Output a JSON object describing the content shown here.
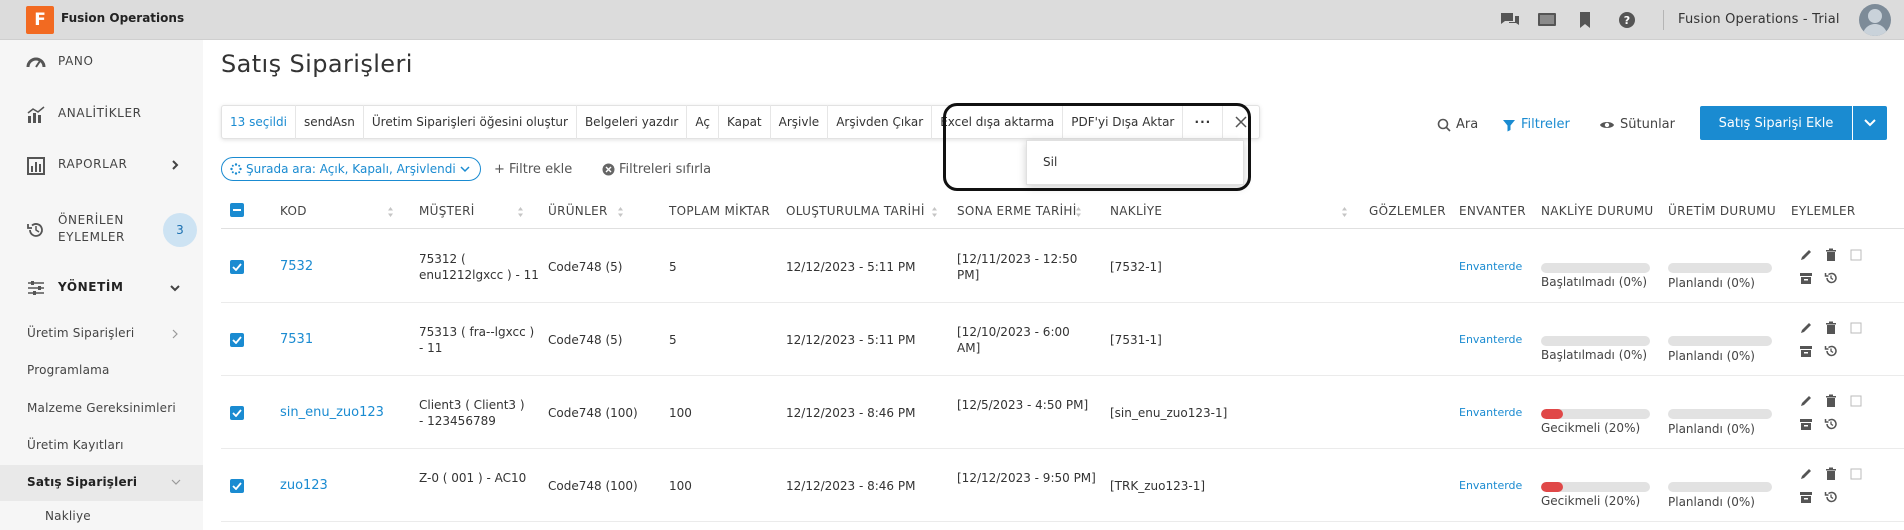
{
  "app": {
    "logo_letter": "F",
    "title": "Fusion Operations",
    "tenant": "Fusion Operations - Trial"
  },
  "topbar_icons": [
    "chat-icon",
    "screen-icon",
    "bookmark-icon",
    "help-icon"
  ],
  "sidebar": {
    "items": [
      {
        "label": "PANO",
        "icon": "dashboard-icon"
      },
      {
        "label": "ANALİTİKLER",
        "icon": "analytics-icon"
      },
      {
        "label": "RAPORLAR",
        "icon": "reports-icon"
      },
      {
        "label": "ÖNERİLEN",
        "label2": "EYLEMLER",
        "icon": "history-icon",
        "badge": "3"
      },
      {
        "label": "YÖNETİM",
        "icon": "settings-sliders-icon"
      }
    ],
    "sub_items": [
      "Üretim Siparişleri",
      "Programlama",
      "Malzeme Gereksinimleri",
      "Üretim Kayıtları",
      "Satış Siparişleri"
    ],
    "sub_sub_item": "Nakliye"
  },
  "page": {
    "title": "Satış Siparişleri"
  },
  "actionbar": {
    "selected": "13 seçildi",
    "items": [
      "sendAsn",
      "Üretim Siparişleri öğesini oluştur",
      "Belgeleri yazdır",
      "Aç",
      "Kapat",
      "Arşivle",
      "Arşivden Çıkar",
      "Excel dışa aktarma",
      "PDF'yi Dışa Aktar"
    ],
    "more": "···"
  },
  "dropdown": {
    "item": "Sil"
  },
  "toolbar": {
    "search": "Ara",
    "filters": "Filtreler",
    "columns": "Sütunlar",
    "add_button": "Satış Siparişi Ekle"
  },
  "filters": {
    "chip": "Şurada ara: Açık, Kapalı, Arşivlendi",
    "add": "+ Filtre ekle",
    "reset": "Filtreleri sıfırla"
  },
  "table": {
    "columns": [
      "KOD",
      "MÜŞTERİ",
      "ÜRÜNLER",
      "TOPLAM MİKTAR",
      "OLUŞTURULMA TARİHİ",
      "SONA ERME TARİHİ",
      "NAKLİYE",
      "GÖZLEMLER",
      "ENVANTER",
      "NAKLİYE DURUMU",
      "ÜRETİM DURUMU",
      "EYLEMLER"
    ],
    "rows": [
      {
        "code": "7532",
        "customer": [
          "75312 (",
          "enu1212lgxcc ) - 11"
        ],
        "products": "Code748 (5)",
        "qty": "5",
        "created": "12/12/2023 - 5:11 PM",
        "expires": [
          "[12/11/2023 - 12:50",
          "PM]"
        ],
        "shipping": "[7532-1]",
        "inventory": "Envanterde",
        "ship_status": "Başlatılmadı (0%)",
        "ship_progress": 0,
        "prod_status": "Planlandı (0%)",
        "prod_progress": 0
      },
      {
        "code": "7531",
        "customer": [
          "75313 ( fra--lgxcc )",
          "- 11"
        ],
        "products": "Code748 (5)",
        "qty": "5",
        "created": "12/12/2023 - 5:11 PM",
        "expires": [
          "[12/10/2023 - 6:00",
          "AM]"
        ],
        "shipping": "[7531-1]",
        "inventory": "Envanterde",
        "ship_status": "Başlatılmadı (0%)",
        "ship_progress": 0,
        "prod_status": "Planlandı (0%)",
        "prod_progress": 0
      },
      {
        "code": "sin_enu_zuo123",
        "customer": [
          "Client3 ( Client3 )",
          "- 123456789"
        ],
        "products": "Code748 (100)",
        "qty": "100",
        "created": "12/12/2023 - 8:46 PM",
        "expires": [
          "[12/5/2023 - 4:50 PM]",
          ""
        ],
        "shipping": "[sin_enu_zuo123-1]",
        "inventory": "Envanterde",
        "ship_status": "Gecikmeli (20%)",
        "ship_progress": 20,
        "prod_status": "Planlandı (0%)",
        "prod_progress": 0
      },
      {
        "code": "zuo123",
        "customer": [
          "Z-0 ( 001 ) - AC10",
          ""
        ],
        "products": "Code748 (100)",
        "qty": "100",
        "created": "12/12/2023 - 8:46 PM",
        "expires": [
          "[12/12/2023 - 9:50 PM]",
          ""
        ],
        "shipping": "[TRK_zuo123-1]",
        "inventory": "Envanterde",
        "ship_status": "Gecikmeli (20%)",
        "ship_progress": 20,
        "prod_status": "Planlandı (0%)",
        "prod_progress": 0
      }
    ]
  },
  "colors": {
    "accent": "#1a8bd1",
    "delay": "#e04848",
    "sidebar_bg": "#f6f6f6",
    "topbar_bg": "#dcdcdc"
  }
}
